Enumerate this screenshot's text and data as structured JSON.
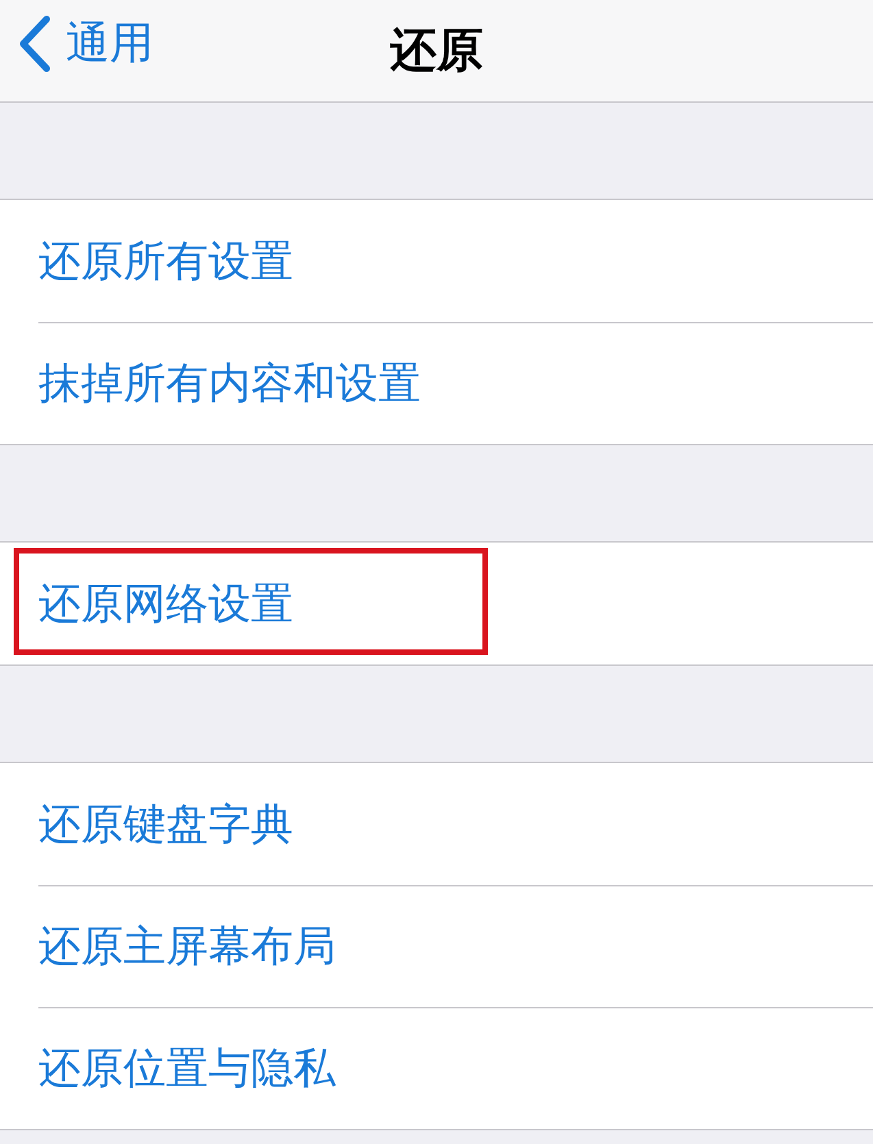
{
  "nav_bar": {
    "back_label": "通用",
    "title": "还原"
  },
  "groups": [
    {
      "items": [
        {
          "label": "还原所有设置",
          "highlighted": false
        },
        {
          "label": "抹掉所有内容和设置",
          "highlighted": false
        }
      ]
    },
    {
      "items": [
        {
          "label": "还原网络设置",
          "highlighted": true
        }
      ]
    },
    {
      "items": [
        {
          "label": "还原键盘字典",
          "highlighted": false
        },
        {
          "label": "还原主屏幕布局",
          "highlighted": false
        },
        {
          "label": "还原位置与隐私",
          "highlighted": false
        }
      ]
    }
  ]
}
